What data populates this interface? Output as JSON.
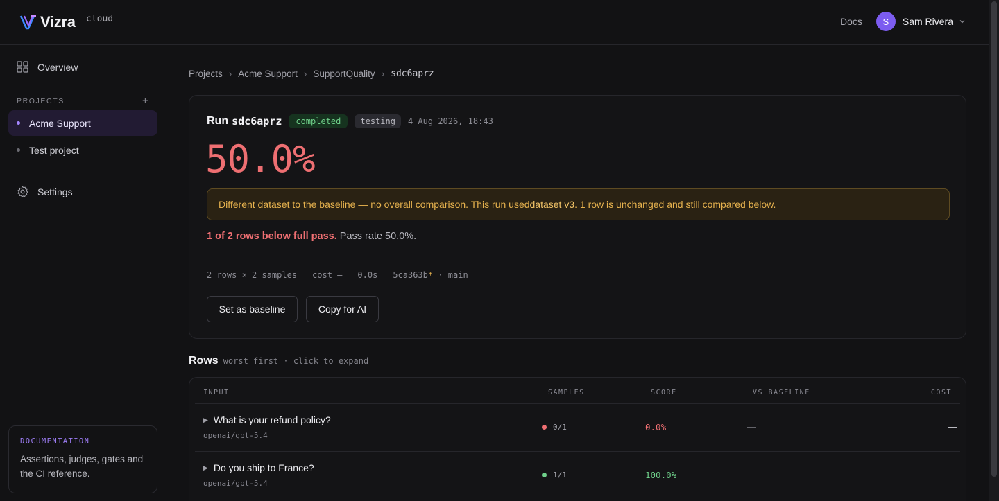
{
  "header": {
    "logo_text": "Vizra",
    "logo_sub": "cloud",
    "docs_label": "Docs",
    "user_initial": "S",
    "user_name": "Sam Rivera"
  },
  "sidebar": {
    "overview_label": "Overview",
    "projects_heading": "PROJECTS",
    "add_symbol": "+",
    "projects": [
      {
        "label": "Acme Support",
        "active": true
      },
      {
        "label": "Test project",
        "active": false
      }
    ],
    "settings_label": "Settings",
    "doc_card": {
      "label": "DOCUMENTATION",
      "text": "Assertions, judges, gates and the CI reference."
    }
  },
  "breadcrumb": {
    "items": [
      "Projects",
      "Acme Support",
      "SupportQuality"
    ],
    "current": "sdc6aprz",
    "separator": "›"
  },
  "run": {
    "label": "Run",
    "id": "sdc6aprz",
    "status": "completed",
    "environment": "testing",
    "date": "4 Aug 2026, 18:43",
    "score": "50.0%",
    "warning": {
      "before": "Different dataset to the baseline — no overall comparison. This run used ",
      "highlight": "dataset v3",
      "after": ". 1 row is unchanged and still compared below."
    },
    "summary_bad": "1 of 2 rows below full pass.",
    "summary_rest": " Pass rate 50.0%.",
    "meta": {
      "rows_samples": "2 rows × 2 samples",
      "cost": "cost —",
      "duration": "0.0s",
      "commit": "5ca363b",
      "dirty_marker": "*",
      "branch": " · main"
    },
    "buttons": {
      "baseline": "Set as baseline",
      "copy_ai": "Copy for AI"
    }
  },
  "rows_section": {
    "title": "Rows",
    "subtitle": "worst first · click to expand",
    "columns": [
      "INPUT",
      "SAMPLES",
      "SCORE",
      "VS BASELINE",
      "COST"
    ],
    "rows": [
      {
        "input": "What is your refund policy?",
        "model": "openai/gpt-5.4",
        "samples": "0/1",
        "score": "0.0%",
        "vs": "—",
        "cost": "—",
        "status_color": "#ee6f72"
      },
      {
        "input": "Do you ship to France?",
        "model": "openai/gpt-5.4",
        "samples": "1/1",
        "score": "100.0%",
        "vs": "—",
        "cost": "—",
        "status_color": "#6fd08a"
      }
    ]
  },
  "colors": {
    "accent": "#7c5cf0",
    "fail": "#ee6f72",
    "pass": "#6fd08a",
    "warning": "#e6b24e"
  }
}
